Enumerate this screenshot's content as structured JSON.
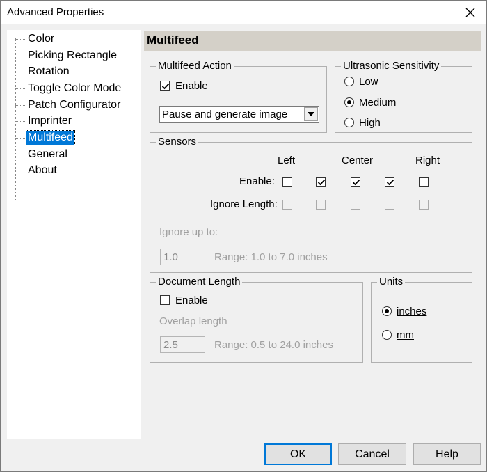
{
  "window": {
    "title": "Advanced Properties"
  },
  "tree": {
    "items": [
      {
        "label": "Color"
      },
      {
        "label": "Picking Rectangle"
      },
      {
        "label": "Rotation"
      },
      {
        "label": "Toggle Color Mode"
      },
      {
        "label": "Patch Configurator"
      },
      {
        "label": "Imprinter"
      },
      {
        "label": "Multifeed"
      },
      {
        "label": "General"
      },
      {
        "label": "About"
      }
    ],
    "selected": "Multifeed"
  },
  "page": {
    "title": "Multifeed"
  },
  "multifeed_action": {
    "title": "Multifeed Action",
    "enable_label": "Enable",
    "enable_checked": true,
    "action_value": "Pause and generate image"
  },
  "ultrasonic": {
    "title": "Ultrasonic Sensitivity",
    "options": [
      {
        "label": "Low"
      },
      {
        "label": "Medium"
      },
      {
        "label": "High"
      }
    ],
    "selected": "Medium"
  },
  "sensors": {
    "title": "Sensors",
    "col_left": "Left",
    "col_center": "Center",
    "col_right": "Right",
    "enable_label": "Enable:",
    "ignore_length_label": "Ignore Length:",
    "enable_states": [
      false,
      true,
      true,
      true,
      false
    ],
    "ignore_states": [
      false,
      false,
      false,
      false,
      false
    ],
    "ignore_up_to_label": "Ignore up to:",
    "ignore_up_to_value": "1.0",
    "range_text": "Range: 1.0 to 7.0 inches"
  },
  "document_length": {
    "title": "Document Length",
    "enable_label": "Enable",
    "enable_checked": false,
    "overlap_label": "Overlap length",
    "overlap_value": "2.5",
    "range_text": "Range: 0.5 to 24.0 inches"
  },
  "units": {
    "title": "Units",
    "options": [
      {
        "label": "inches"
      },
      {
        "label": "mm"
      }
    ],
    "selected": "inches"
  },
  "buttons": {
    "ok": "OK",
    "cancel": "Cancel",
    "help": "Help"
  }
}
